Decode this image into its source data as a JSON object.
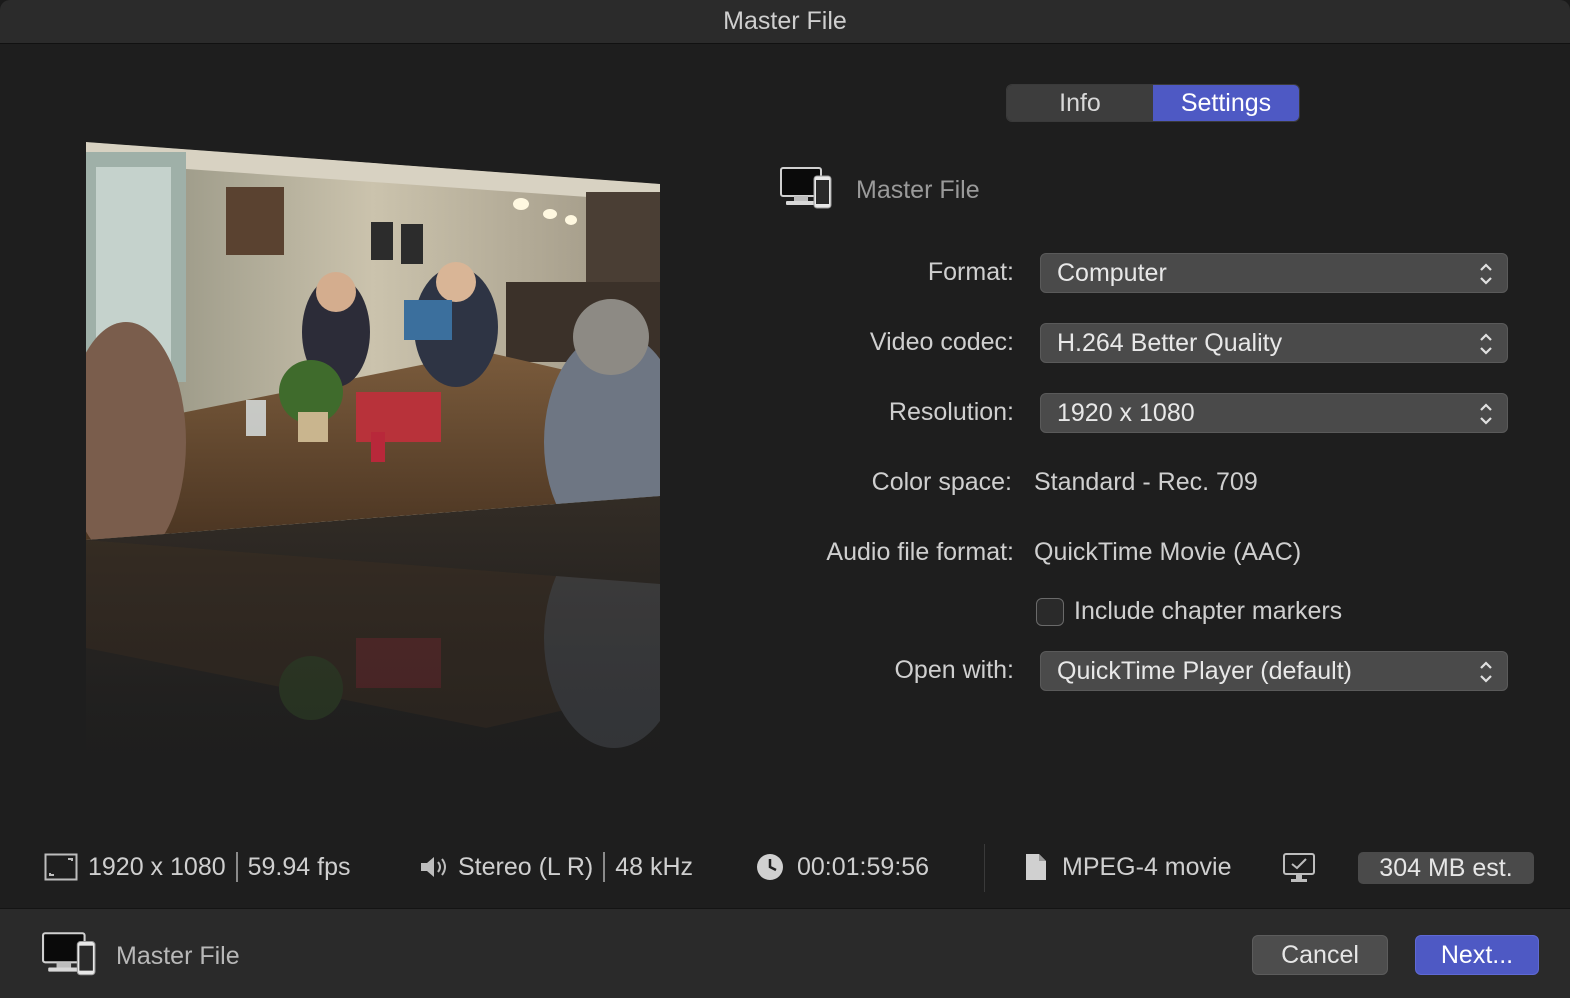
{
  "window": {
    "title": "Master File"
  },
  "tabs": [
    {
      "label": "Info",
      "active": false
    },
    {
      "label": "Settings",
      "active": true
    }
  ],
  "destination": {
    "name": "Master File",
    "icon": "computer-device-icon"
  },
  "settings": {
    "format": {
      "label": "Format:",
      "value": "Computer"
    },
    "video_codec": {
      "label": "Video codec:",
      "value": "H.264 Better Quality"
    },
    "resolution": {
      "label": "Resolution:",
      "value": "1920 x 1080"
    },
    "color_space": {
      "label": "Color space:",
      "value": "Standard - Rec. 709"
    },
    "audio_file_format": {
      "label": "Audio file format:",
      "value": "QuickTime Movie (AAC)"
    },
    "chapter_markers": {
      "label": "Include chapter markers",
      "checked": false
    },
    "open_with": {
      "label": "Open with:",
      "value": "QuickTime Player (default)"
    }
  },
  "info_bar": {
    "resolution": "1920 x 1080",
    "frame_rate": "59.94 fps",
    "audio_channels": "Stereo (L R)",
    "sample_rate": "48 kHz",
    "duration": "00:01:59:56",
    "file_type": "MPEG-4 movie",
    "size_estimate": "304 MB est."
  },
  "footer": {
    "destination_name": "Master File",
    "cancel_label": "Cancel",
    "next_label": "Next..."
  },
  "colors": {
    "accent": "#4e59c4",
    "background": "#1e1e1e",
    "popup": "#4a4a4a"
  }
}
